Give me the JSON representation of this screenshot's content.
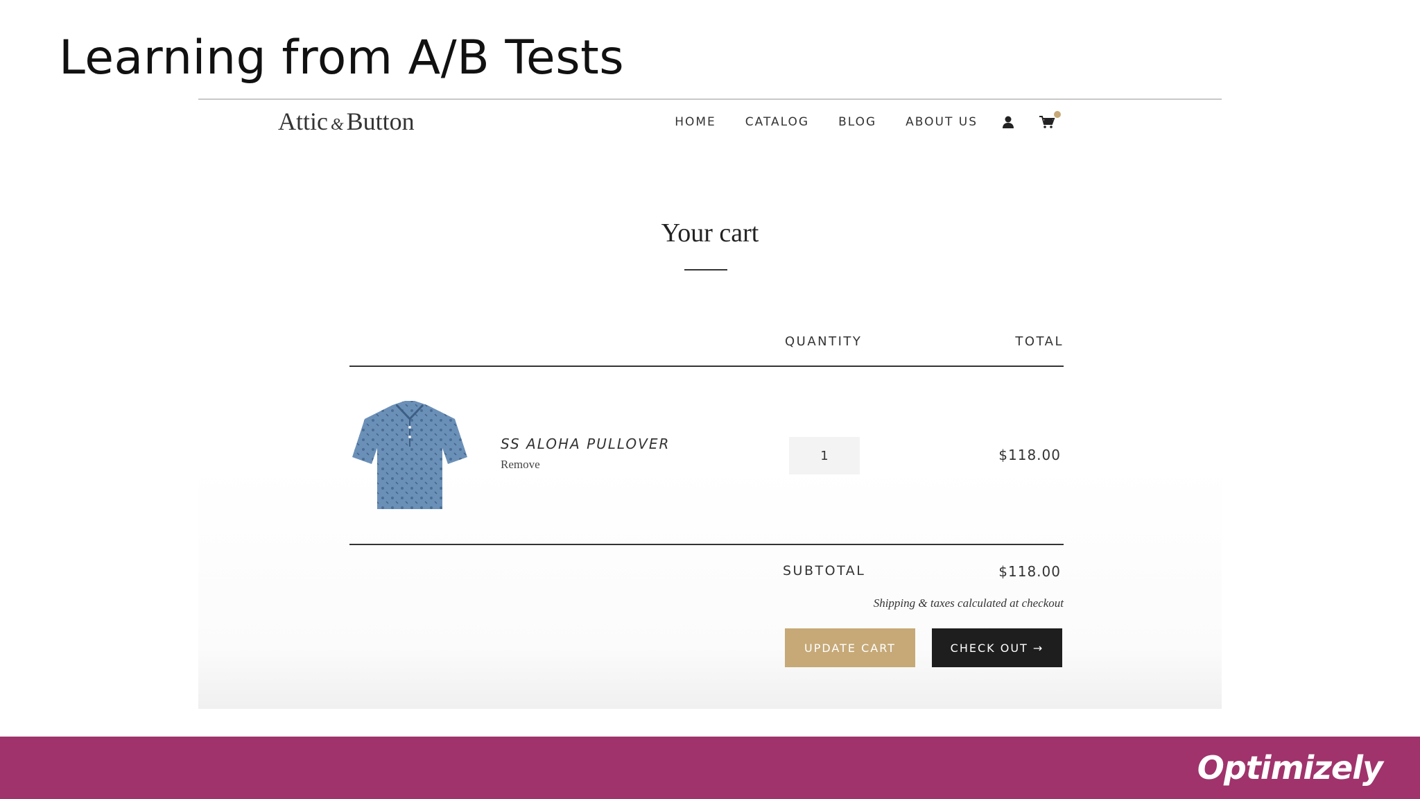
{
  "slide": {
    "title": "Learning from A/B Tests",
    "brand": "Optimizely",
    "accent_color": "#a0336b"
  },
  "store": {
    "logo_part1": "Attic",
    "logo_amp": "&",
    "logo_part2": "Button",
    "nav": [
      "HOME",
      "CATALOG",
      "BLOG",
      "ABOUT US"
    ],
    "icons": [
      "account-icon",
      "cart-icon"
    ],
    "cart_dot_color": "#c6a977"
  },
  "cart": {
    "heading": "Your cart",
    "col_quantity": "QUANTITY",
    "col_total": "TOTAL",
    "item": {
      "name": "SS ALOHA PULLOVER",
      "remove_label": "Remove",
      "quantity": "1",
      "total": "$118.00"
    },
    "subtotal_label": "SUBTOTAL",
    "subtotal_value": "$118.00",
    "shipping_note": "Shipping & taxes calculated at checkout",
    "update_label": "UPDATE CART",
    "update_color": "#c6a977",
    "checkout_label": "CHECK OUT →"
  }
}
